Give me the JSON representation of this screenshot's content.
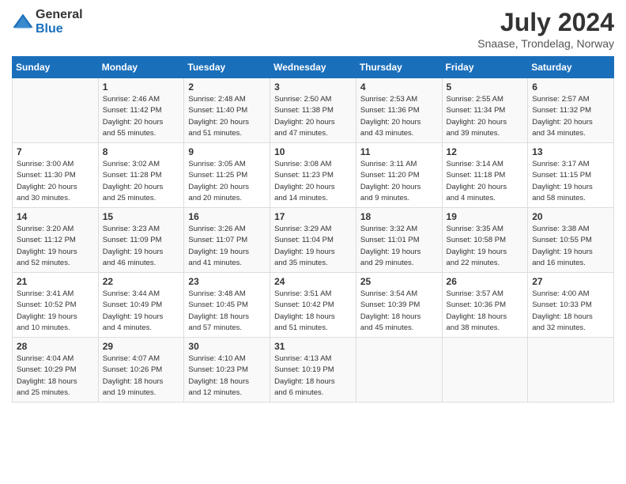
{
  "logo": {
    "line1": "General",
    "line2": "Blue"
  },
  "title": "July 2024",
  "location": "Snaase, Trondelag, Norway",
  "days_of_week": [
    "Sunday",
    "Monday",
    "Tuesday",
    "Wednesday",
    "Thursday",
    "Friday",
    "Saturday"
  ],
  "weeks": [
    [
      {
        "day": "",
        "info": ""
      },
      {
        "day": "1",
        "info": "Sunrise: 2:46 AM\nSunset: 11:42 PM\nDaylight: 20 hours\nand 55 minutes."
      },
      {
        "day": "2",
        "info": "Sunrise: 2:48 AM\nSunset: 11:40 PM\nDaylight: 20 hours\nand 51 minutes."
      },
      {
        "day": "3",
        "info": "Sunrise: 2:50 AM\nSunset: 11:38 PM\nDaylight: 20 hours\nand 47 minutes."
      },
      {
        "day": "4",
        "info": "Sunrise: 2:53 AM\nSunset: 11:36 PM\nDaylight: 20 hours\nand 43 minutes."
      },
      {
        "day": "5",
        "info": "Sunrise: 2:55 AM\nSunset: 11:34 PM\nDaylight: 20 hours\nand 39 minutes."
      },
      {
        "day": "6",
        "info": "Sunrise: 2:57 AM\nSunset: 11:32 PM\nDaylight: 20 hours\nand 34 minutes."
      }
    ],
    [
      {
        "day": "7",
        "info": "Sunrise: 3:00 AM\nSunset: 11:30 PM\nDaylight: 20 hours\nand 30 minutes."
      },
      {
        "day": "8",
        "info": "Sunrise: 3:02 AM\nSunset: 11:28 PM\nDaylight: 20 hours\nand 25 minutes."
      },
      {
        "day": "9",
        "info": "Sunrise: 3:05 AM\nSunset: 11:25 PM\nDaylight: 20 hours\nand 20 minutes."
      },
      {
        "day": "10",
        "info": "Sunrise: 3:08 AM\nSunset: 11:23 PM\nDaylight: 20 hours\nand 14 minutes."
      },
      {
        "day": "11",
        "info": "Sunrise: 3:11 AM\nSunset: 11:20 PM\nDaylight: 20 hours\nand 9 minutes."
      },
      {
        "day": "12",
        "info": "Sunrise: 3:14 AM\nSunset: 11:18 PM\nDaylight: 20 hours\nand 4 minutes."
      },
      {
        "day": "13",
        "info": "Sunrise: 3:17 AM\nSunset: 11:15 PM\nDaylight: 19 hours\nand 58 minutes."
      }
    ],
    [
      {
        "day": "14",
        "info": "Sunrise: 3:20 AM\nSunset: 11:12 PM\nDaylight: 19 hours\nand 52 minutes."
      },
      {
        "day": "15",
        "info": "Sunrise: 3:23 AM\nSunset: 11:09 PM\nDaylight: 19 hours\nand 46 minutes."
      },
      {
        "day": "16",
        "info": "Sunrise: 3:26 AM\nSunset: 11:07 PM\nDaylight: 19 hours\nand 41 minutes."
      },
      {
        "day": "17",
        "info": "Sunrise: 3:29 AM\nSunset: 11:04 PM\nDaylight: 19 hours\nand 35 minutes."
      },
      {
        "day": "18",
        "info": "Sunrise: 3:32 AM\nSunset: 11:01 PM\nDaylight: 19 hours\nand 29 minutes."
      },
      {
        "day": "19",
        "info": "Sunrise: 3:35 AM\nSunset: 10:58 PM\nDaylight: 19 hours\nand 22 minutes."
      },
      {
        "day": "20",
        "info": "Sunrise: 3:38 AM\nSunset: 10:55 PM\nDaylight: 19 hours\nand 16 minutes."
      }
    ],
    [
      {
        "day": "21",
        "info": "Sunrise: 3:41 AM\nSunset: 10:52 PM\nDaylight: 19 hours\nand 10 minutes."
      },
      {
        "day": "22",
        "info": "Sunrise: 3:44 AM\nSunset: 10:49 PM\nDaylight: 19 hours\nand 4 minutes."
      },
      {
        "day": "23",
        "info": "Sunrise: 3:48 AM\nSunset: 10:45 PM\nDaylight: 18 hours\nand 57 minutes."
      },
      {
        "day": "24",
        "info": "Sunrise: 3:51 AM\nSunset: 10:42 PM\nDaylight: 18 hours\nand 51 minutes."
      },
      {
        "day": "25",
        "info": "Sunrise: 3:54 AM\nSunset: 10:39 PM\nDaylight: 18 hours\nand 45 minutes."
      },
      {
        "day": "26",
        "info": "Sunrise: 3:57 AM\nSunset: 10:36 PM\nDaylight: 18 hours\nand 38 minutes."
      },
      {
        "day": "27",
        "info": "Sunrise: 4:00 AM\nSunset: 10:33 PM\nDaylight: 18 hours\nand 32 minutes."
      }
    ],
    [
      {
        "day": "28",
        "info": "Sunrise: 4:04 AM\nSunset: 10:29 PM\nDaylight: 18 hours\nand 25 minutes."
      },
      {
        "day": "29",
        "info": "Sunrise: 4:07 AM\nSunset: 10:26 PM\nDaylight: 18 hours\nand 19 minutes."
      },
      {
        "day": "30",
        "info": "Sunrise: 4:10 AM\nSunset: 10:23 PM\nDaylight: 18 hours\nand 12 minutes."
      },
      {
        "day": "31",
        "info": "Sunrise: 4:13 AM\nSunset: 10:19 PM\nDaylight: 18 hours\nand 6 minutes."
      },
      {
        "day": "",
        "info": ""
      },
      {
        "day": "",
        "info": ""
      },
      {
        "day": "",
        "info": ""
      }
    ]
  ]
}
